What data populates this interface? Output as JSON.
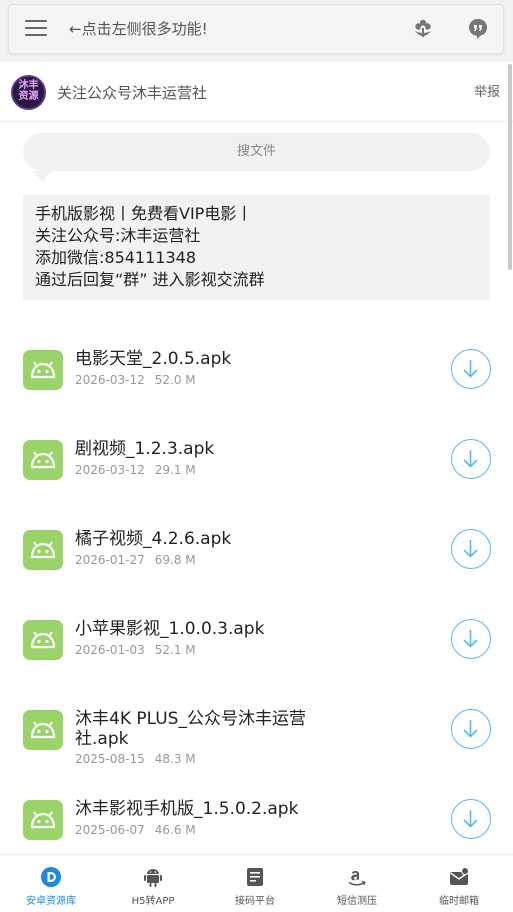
{
  "topbar": {
    "hint": "←点击左侧很多功能!",
    "menu_icon": "hamburger-icon",
    "right_icons": [
      "flower-icon",
      "quote-bubble-icon"
    ]
  },
  "header": {
    "avatar_text_line1": "沐丰",
    "avatar_text_line2": "资源",
    "title": "关注公众号沐丰运营社",
    "report": "举报"
  },
  "search": {
    "placeholder": "搜文件"
  },
  "notice": {
    "lines": [
      "手机版影视丨免费看VIP电影丨",
      "关注公众号:沐丰运营社",
      "添加微信:854111348",
      "通过后回复“群” 进入影视交流群"
    ]
  },
  "files": [
    {
      "name": "电影天堂_2.0.5.apk",
      "date": "2026-03-12",
      "size": "52.0 M"
    },
    {
      "name": "剧视频_1.2.3.apk",
      "date": "2026-03-12",
      "size": "29.1 M"
    },
    {
      "name": "橘子视频_4.2.6.apk",
      "date": "2026-01-27",
      "size": "69.8 M"
    },
    {
      "name": "小苹果影视_1.0.0.3.apk",
      "date": "2026-01-03",
      "size": "52.1 M"
    },
    {
      "name": "沐丰4K PLUS_公众号沐丰运营社.apk",
      "date": "2025-08-15",
      "size": "48.3 M"
    },
    {
      "name": "沐丰影视手机版_1.5.0.2.apk",
      "date": "2025-06-07",
      "size": "46.6 M"
    }
  ],
  "bottom_nav": [
    {
      "label": "安卓资源库",
      "icon": "d-logo-icon",
      "active": true
    },
    {
      "label": "H5转APP",
      "icon": "android-icon",
      "active": false
    },
    {
      "label": "接码平台",
      "icon": "document-icon",
      "active": false
    },
    {
      "label": "短信测压",
      "icon": "amazon-icon",
      "active": false
    },
    {
      "label": "临时邮箱",
      "icon": "mail-icon",
      "active": false
    }
  ],
  "colors": {
    "accent": "#1e88e5",
    "download": "#5ab8f0",
    "android_green": "#9ad36a"
  }
}
